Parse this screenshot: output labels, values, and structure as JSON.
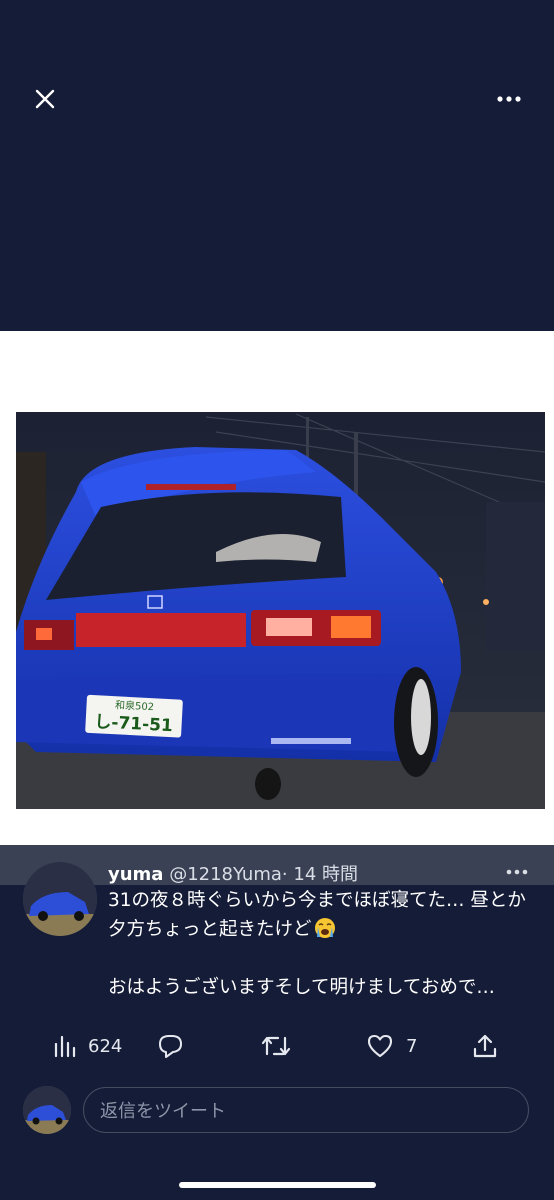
{
  "icons": {
    "close": "close-icon",
    "more": "more-horizontal-icon",
    "views": "bar-chart-icon",
    "reply": "reply-bubble-icon",
    "retweet": "retweet-icon",
    "like": "heart-icon",
    "share": "share-upload-icon"
  },
  "tweet": {
    "author_name": "yuma",
    "handle": "@1218Yuma",
    "separator": "·",
    "time": "14 時間",
    "text_line1": "31の夜８時ぐらいから今までほぼ寝てた… 昼とか夕方ちょっと起きたけど",
    "emoji": "loudly-crying-face",
    "text_line2": "おはようございますそして明けましておめで…"
  },
  "actions": {
    "views_count": "624",
    "like_count": "7"
  },
  "reply": {
    "placeholder": "返信をツイート"
  },
  "photo": {
    "plate_top": "和泉502",
    "plate_number": "し-71-51"
  },
  "colors": {
    "background": "#151c37",
    "media_frame": "#ffffff",
    "car_blue": "#1f3fc9"
  }
}
